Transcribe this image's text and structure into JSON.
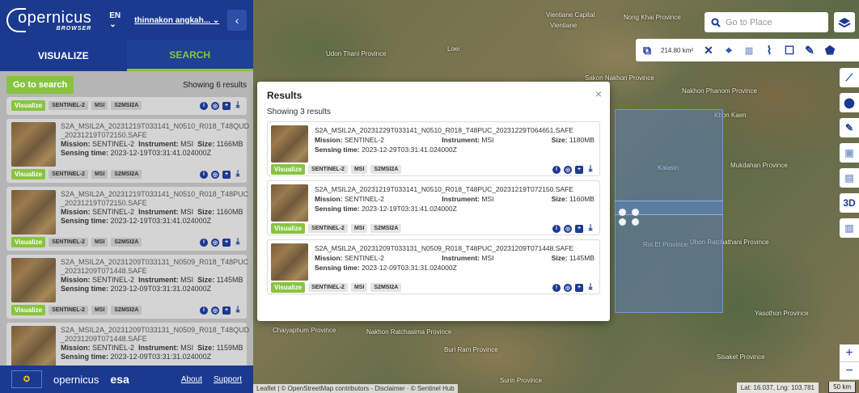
{
  "header": {
    "app_name": "opernicus",
    "app_subtitle": "BROWSER",
    "language": "EN",
    "user": "thinnakon angkah...",
    "collapse_glyph": "‹"
  },
  "tabs": [
    {
      "label": "VISUALIZE"
    },
    {
      "label": "SEARCH"
    }
  ],
  "search": {
    "go_button": "Go to search",
    "showing": "Showing 6 results"
  },
  "sidebar_results": [
    {
      "name": "S2A_MSIL2A_20231219T033141_N0510_R018_T48QUD _20231219T072150.SAFE",
      "mission": "SENTINEL-2",
      "instrument": "MSI",
      "size": "1166MB",
      "sensing": "2023-12-19T03:31:41.024000Z"
    },
    {
      "name": "S2A_MSIL2A_20231219T033141_N0510_R018_T48PUC _20231219T072150.SAFE",
      "mission": "SENTINEL-2",
      "instrument": "MSI",
      "size": "1160MB",
      "sensing": "2023-12-19T03:31:41.024000Z"
    },
    {
      "name": "S2A_MSIL2A_20231209T033131_N0509_R018_T48PUC _20231209T071448.SAFE",
      "mission": "SENTINEL-2",
      "instrument": "MSI",
      "size": "1145MB",
      "sensing": "2023-12-09T03:31:31.024000Z"
    },
    {
      "name": "S2A_MSIL2A_20231209T033131_N0509_R018_T48QUD _20231209T071448.SAFE",
      "mission": "SENTINEL-2",
      "instrument": "MSI",
      "size": "1159MB",
      "sensing": "2023-12-09T03:31:31.024000Z"
    }
  ],
  "labels": {
    "visualize": "Visualize",
    "mission": "Mission:",
    "instrument": "Instrument:",
    "size": "Size:",
    "sensing": "Sensing time:",
    "tag1": "SENTINEL-2",
    "tag2": "MSI",
    "tag3": "S2MSI2A"
  },
  "modal": {
    "title": "Results",
    "close": "×",
    "showing": "Showing 3 results",
    "results": [
      {
        "name": "S2A_MSIL2A_20231229T033141_N0510_R018_T48PUC_20231229T064651.SAFE",
        "mission": "SENTINEL-2",
        "instrument": "MSI",
        "size": "1180MB",
        "sensing": "2023-12-29T03:31:41.024000Z"
      },
      {
        "name": "S2A_MSIL2A_20231219T033141_N0510_R018_T48PUC_20231219T072150.SAFE",
        "mission": "SENTINEL-2",
        "instrument": "MSI",
        "size": "1160MB",
        "sensing": "2023-12-19T03:31:41.024000Z"
      },
      {
        "name": "S2A_MSIL2A_20231209T033131_N0509_R018_T48PUC_20231209T071448.SAFE",
        "mission": "SENTINEL-2",
        "instrument": "MSI",
        "size": "1145MB",
        "sensing": "2023-12-09T03:31:31.024000Z"
      }
    ]
  },
  "map": {
    "goto_placeholder": "Go to Place",
    "area": "214.80 km²",
    "attribution": "Leaflet | © OpenStreetMap contributors - Disclaimer · © Sentinel Hub",
    "coords": "Lat: 16.037, Lng: 103.781",
    "scale": "50 km",
    "place_labels": [
      "Vientiane Capital",
      "Vientiane",
      "Nong Khai Province",
      "Udon Thani Province",
      "Sakon Nakhon Province",
      "Nakhon Phanom Province",
      "Kalasin",
      "Mukdahan Province",
      "Roi Et Province",
      "Khon Kaen",
      "Yasothon Province",
      "Chaiyaphum Province",
      "Nakhon Ratchasima Province",
      "Buri Ram Province",
      "Sisaket Province",
      "Ubon Ratchathani Province",
      "Surin Province",
      "Loei"
    ]
  },
  "footer": {
    "brand": "opernicus",
    "agency": "esa",
    "about": "About",
    "support": "Support"
  }
}
